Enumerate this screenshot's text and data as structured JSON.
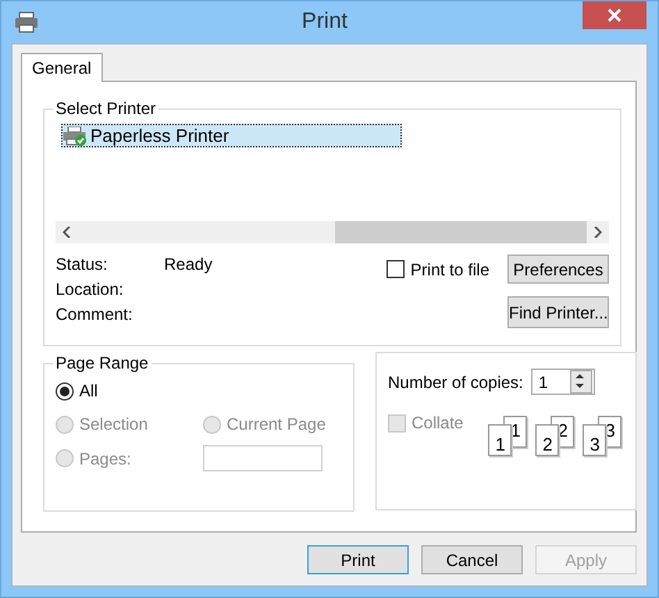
{
  "window": {
    "title": "Print"
  },
  "tabs": [
    {
      "label": "General",
      "selected": true
    }
  ],
  "select_printer": {
    "legend": "Select Printer",
    "printers": [
      {
        "name": "Paperless Printer",
        "selected": true
      }
    ],
    "status": [
      {
        "label": "Status:",
        "value": "Ready"
      },
      {
        "label": "Location:"
      },
      {
        "label": "Comment:"
      }
    ],
    "print_to_file": {
      "label": "Print to file",
      "checked": false
    },
    "buttons": [
      "Preferences",
      "Find Printer..."
    ]
  },
  "page_range": {
    "legend": "Page Range",
    "options": [
      {
        "label": "All",
        "selected": true,
        "disabled": false
      },
      {
        "label": "Selection",
        "selected": false,
        "disabled": true
      },
      {
        "label": "Current Page",
        "selected": false,
        "disabled": true
      },
      {
        "label": "Pages:",
        "selected": false,
        "disabled": true
      }
    ]
  },
  "copies": {
    "label": "Number of copies:",
    "value": "1",
    "collate": {
      "label": "Collate",
      "checked": false,
      "disabled": true
    },
    "collate_pages": [
      [
        "1",
        "1"
      ],
      [
        "2",
        "2"
      ],
      [
        "3",
        "3"
      ]
    ]
  },
  "dialog_buttons": [
    {
      "label": "Print",
      "default": true,
      "disabled": false
    },
    {
      "label": "Cancel",
      "default": false,
      "disabled": false
    },
    {
      "label": "Apply",
      "default": false,
      "disabled": true
    }
  ]
}
